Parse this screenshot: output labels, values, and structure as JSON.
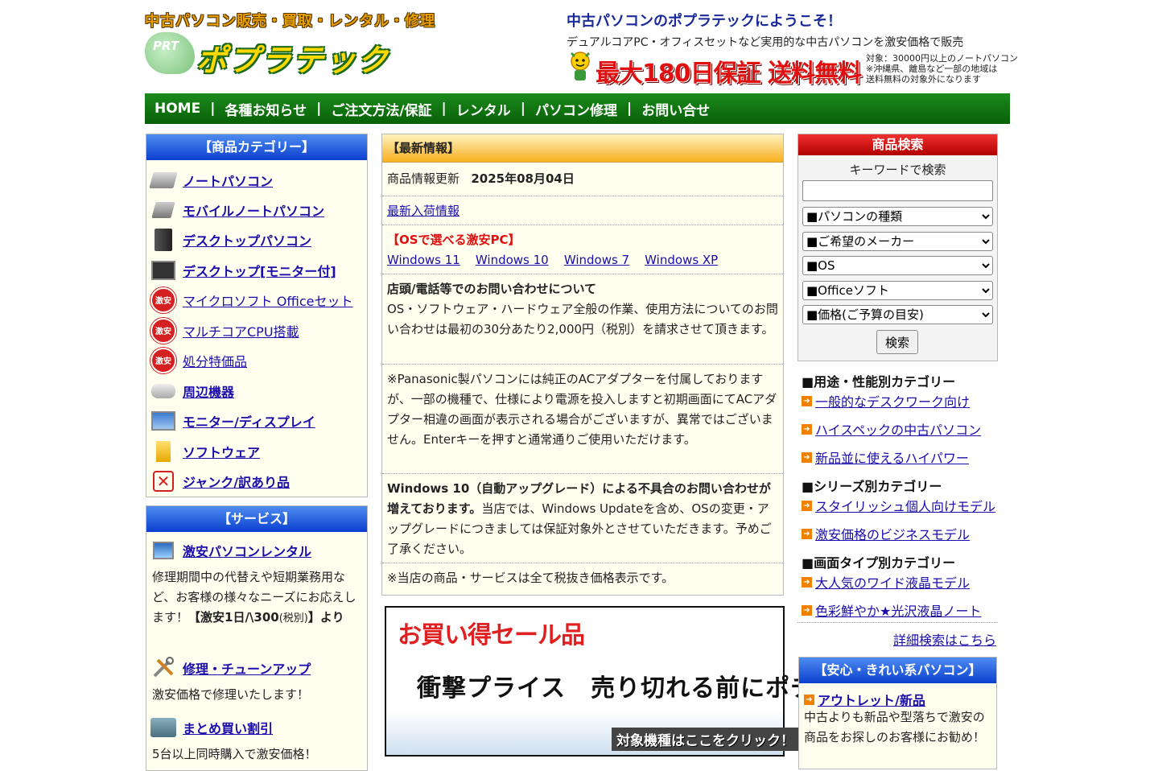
{
  "header": {
    "logo_tagline": "中古パソコン販売・買取・レンタル・修理",
    "logo_prt": "PRT",
    "logo_name": "ポプラテック",
    "welcome": "中古パソコンのポプラテックにようこそ！",
    "tagline": "デュアルコアPC・オフィスセットなど実用的な中古パソコンを激安価格で販売",
    "promo": "最大180日保証 送料無料",
    "promo_note": [
      "対象：30000円以上のノートパソコン",
      "※沖縄県、離島など一部の地域は",
      "送料無料の対象外になります"
    ]
  },
  "nav": {
    "items": [
      "HOME",
      "各種お知らせ",
      "ご注文方法/保証",
      "レンタル",
      "パソコン修理",
      "お問い合せ"
    ],
    "separator": "|"
  },
  "categories": {
    "title": "【商品カテゴリー】",
    "items": [
      {
        "label": "ノートパソコン",
        "icon": "laptop-icon"
      },
      {
        "label": "モバイルノートパソコン",
        "icon": "mobile-laptop-icon"
      },
      {
        "label": "デスクトップパソコン",
        "icon": "desktop-tower-icon"
      },
      {
        "label": "デスクトップ[モニター付]",
        "icon": "desktop-monitor-icon"
      },
      {
        "label": "マイクロソフト Officeセット",
        "icon": "gekiyasu-badge-icon"
      },
      {
        "label": "マルチコアCPU搭載",
        "icon": "gekiyasu-badge-icon"
      },
      {
        "label": "処分特価品",
        "icon": "gekiyasu-badge-icon"
      },
      {
        "label": "周辺機器",
        "icon": "peripheral-icon"
      },
      {
        "label": "モニター/ディスプレイ",
        "icon": "monitor-icon"
      },
      {
        "label": "ソフトウェア",
        "icon": "software-icon"
      },
      {
        "label": "ジャンク/訳あり品",
        "icon": "junk-icon"
      }
    ],
    "badge_text": "激安"
  },
  "services": {
    "title": "【サービス】",
    "rental_link": "激安パソコンレンタル",
    "rental_desc": "修理期間中の代替えや短期業務用など、お客様の様々なニーズにお応えします！",
    "rental_price": "【激安1日/\\300",
    "rental_tax": "(税別)",
    "rental_tail": "】より",
    "repair_link": "修理・チューンアップ",
    "repair_desc": "激安価格で修理いたします！",
    "bulk_link": "まとめ買い割引",
    "bulk_desc": "5台以上同時購入で激安価格！"
  },
  "news": {
    "title": "【最新情報】",
    "update_label": "商品情報更新",
    "update_date": "2025年08月04日",
    "arrivals_link": "最新入荷情報",
    "os_heading": "【OSで選べる激安PC】",
    "os_links": [
      "Windows 11",
      "Windows 10",
      "Windows 7",
      "Windows XP"
    ],
    "inquiry_heading": "店頭/電話等でのお問い合わせについて",
    "inquiry_text": "OS・ソフトウェア・ハードウェア全般の作業、使用方法についてのお問い合わせは最初の30分あたり2,000円（税別）を請求させて頂きます。",
    "panasonic_text": "※Panasonic製パソコンには純正のACアダプターを付属しておりますが、一部の機種で、仕様により電源を投入しますと初期画面にてACアダプター相違の画面が表示される場合がございますが、異常ではございません。Enterキーを押すと通常通りご使用いただけます。",
    "win10_heading": "Windows 10（自動アップグレード）による不具合のお問い合わせが増えております。",
    "win10_text": "当店では、Windows Updateを含め、OSの変更・アップグレードにつきましては保証対象外とさせていただきます。予めご了承ください。",
    "tax_note": "※当店の商品・サービスは全て税抜き価格表示です。"
  },
  "sale_banner": {
    "title": "お買い得セール品",
    "subtitle": "衝撃プライス　売り切れる前にポチっと",
    "click": "対象機種はここをクリック！"
  },
  "search": {
    "title": "商品検索",
    "keyword_label": "キーワードで検索",
    "keyword_value": "",
    "selects": [
      "■パソコンの種類",
      "■ご希望のメーカー",
      "■OS",
      "■Officeソフト",
      "■価格(ご予算の目安)"
    ],
    "button": "検索"
  },
  "right_categories": {
    "usage_heading": "■用途・性能別カテゴリー",
    "usage_links": [
      "一般的なデスクワーク向け",
      "ハイスペックの中古パソコン",
      "新品並に使えるハイパワー"
    ],
    "series_heading": "■シリーズ別カテゴリー",
    "series_links": [
      "スタイリッシュ個人向けモデル",
      "激安価格のビジネスモデル"
    ],
    "screen_heading": "■画面タイプ別カテゴリー",
    "screen_links": [
      "大人気のワイド液晶モデル",
      "色彩鮮やか★光沢液晶ノート"
    ],
    "detail_link": "詳細検索はこちら"
  },
  "safe": {
    "title": "【安心・きれい系パソコン】",
    "link": "アウトレット/新品",
    "desc": "中古よりも新品や型落ちで激安の商品をお探しのお客様にお勧め！"
  }
}
